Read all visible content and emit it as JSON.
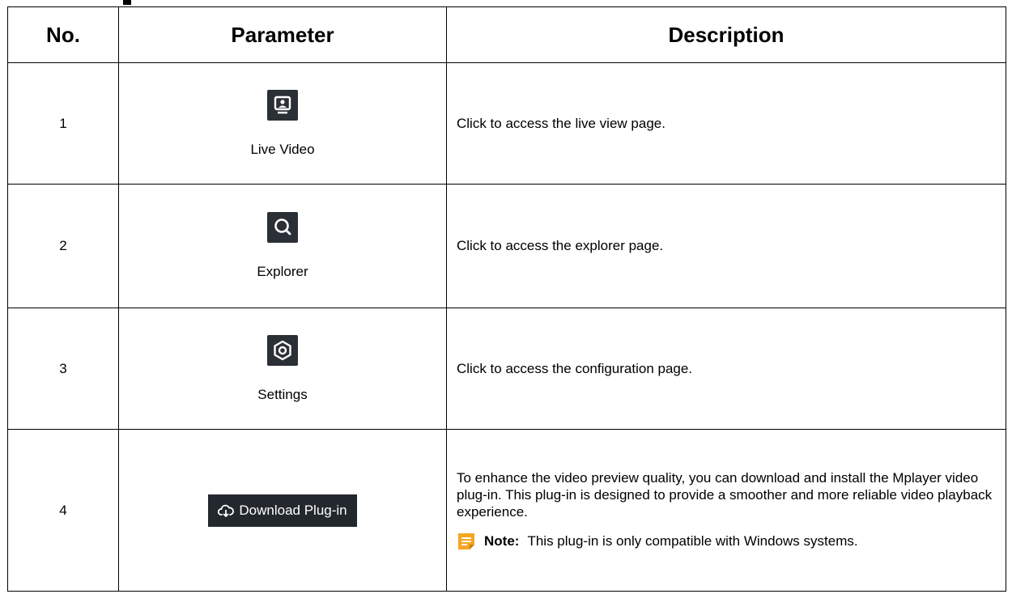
{
  "table": {
    "headers": {
      "no": "No.",
      "parameter": "Parameter",
      "description": "Description"
    },
    "rows": [
      {
        "no": "1",
        "icon": "live-video-monitor-icon",
        "label": "Live Video",
        "description": "Click to access the live view page."
      },
      {
        "no": "2",
        "icon": "magnifier-search-icon",
        "label": "Explorer",
        "description": "Click to access the explorer page."
      },
      {
        "no": "3",
        "icon": "gear-settings-icon",
        "label": "Settings",
        "description": "Click to access the configuration page."
      },
      {
        "no": "4",
        "icon": "download-cloud-icon",
        "label": "Download Plug-in",
        "description": "To enhance the video preview quality, you can download and install the Mplayer video plug-in. This plug-in is designed to provide a smoother and more reliable video playback experience.",
        "note_label": "Note:",
        "note_text": "This plug-in is only compatible with Windows systems."
      }
    ]
  },
  "colors": {
    "icon_tile": "#2b2f36",
    "note_icon": "#f5a623"
  }
}
